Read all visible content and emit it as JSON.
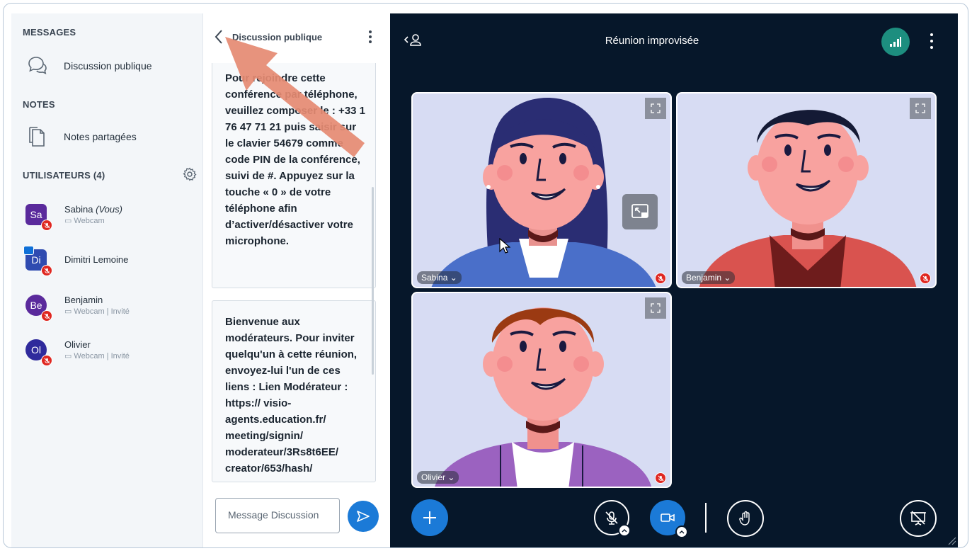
{
  "sidebar": {
    "messages_title": "MESSAGES",
    "public_chat_label": "Discussion publique",
    "notes_title": "NOTES",
    "shared_notes_label": "Notes partagées",
    "users_title": "UTILISATEURS (4)",
    "users": [
      {
        "initials": "Sa",
        "name": "Sabina",
        "you": "(Vous)",
        "sub": "Webcam",
        "color": "#5a2a9c"
      },
      {
        "initials": "Di",
        "name": "Dimitri Lemoine",
        "you": "",
        "sub": "",
        "color": "#2f4bb0"
      },
      {
        "initials": "Be",
        "name": "Benjamin",
        "you": "",
        "sub": "Webcam | Invité",
        "color": "#5a2a9c"
      },
      {
        "initials": "Ol",
        "name": "Olivier",
        "you": "",
        "sub": "Webcam | Invité",
        "color": "#2f2a9c"
      }
    ]
  },
  "chat": {
    "title": "Discussion publique",
    "message1": "Pour rejoindre cette conférence par téléphone, veuillez composer le : +33 1 76 47 71 21 puis saisir sur le clavier 54679 comme code PIN de la conférence, suivi de #. Appuyez sur la touche « 0 » de votre téléphone afin d’activer/désactiver votre microphone.",
    "message2": "Bienvenue aux modérateurs. Pour inviter quelqu'un à cette réunion, envoyez-lui l'un de ces liens : Lien Modérateur : https:// visio- agents.education.fr/ meeting/signin/ moderateur/3Rs8t6EE/ creator/653/hash/",
    "input_placeholder": "Message Discussion"
  },
  "meeting": {
    "title": "Réunion improvisée",
    "tiles": [
      {
        "name": "Sabina"
      },
      {
        "name": "Benjamin"
      },
      {
        "name": "Olivier"
      }
    ]
  },
  "colors": {
    "accent_blue": "#1b7ad7",
    "meeting_bg": "#06172a",
    "muted_red": "#df2721",
    "connection_green": "#1d8e7f",
    "annotation_arrow": "#e58a72"
  }
}
